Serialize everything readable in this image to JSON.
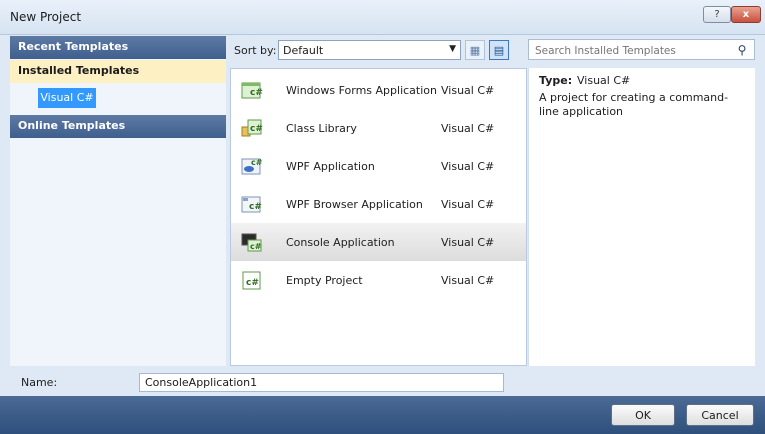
{
  "window": {
    "title": "New Project",
    "help_label": "?",
    "close_label": "x"
  },
  "sidebar": {
    "recent": "Recent Templates",
    "installed": "Installed Templates",
    "installed_sub": "Visual C#",
    "online": "Online Templates"
  },
  "sort": {
    "label": "Sort by:",
    "value": "Default"
  },
  "search": {
    "placeholder": "Search Installed Templates"
  },
  "templates": [
    {
      "name": "Windows Forms Application",
      "lang": "Visual C#",
      "icon": "winforms-icon"
    },
    {
      "name": "Class Library",
      "lang": "Visual C#",
      "icon": "class-library-icon"
    },
    {
      "name": "WPF Application",
      "lang": "Visual C#",
      "icon": "wpf-icon"
    },
    {
      "name": "WPF Browser Application",
      "lang": "Visual C#",
      "icon": "wpf-browser-icon"
    },
    {
      "name": "Console Application",
      "lang": "Visual C#",
      "icon": "console-icon",
      "selected": true
    },
    {
      "name": "Empty Project",
      "lang": "Visual C#",
      "icon": "empty-project-icon"
    }
  ],
  "info": {
    "type_label": "Type:",
    "type_value": "Visual C#",
    "description": "A project for creating a command-line application"
  },
  "name": {
    "label": "Name:",
    "value": "ConsoleApplication1"
  },
  "buttons": {
    "ok": "OK",
    "cancel": "Cancel"
  },
  "colors": {
    "accent": "#3399ff",
    "footer": "#3b5b88",
    "header": "#4a6a98",
    "highlight": "#fdf0c3"
  }
}
